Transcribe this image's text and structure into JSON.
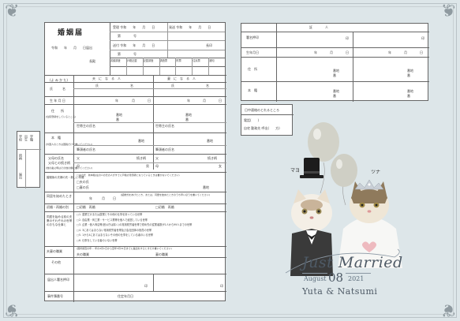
{
  "form": {
    "title": "婚姻届",
    "date_line": "令和　　年　　月　　日届出",
    "addressee": "長殿",
    "receipt": {
      "row1_left": "受理 令和　　年　　月　　日",
      "row1_right": "発送 令和　　年　　月　　日",
      "row2": "第　　　　号",
      "row3": "送付 令和　　年　　月　　日",
      "row3_right": "長印",
      "row4": "第　　　　号",
      "checks": [
        "書類調査",
        "戸籍記載",
        "記載調査",
        "調査票",
        "附票",
        "住民票",
        "通知"
      ]
    },
    "parties": {
      "husband": "夫　に　な　る　人",
      "wife": "妻　に　な　る　人"
    },
    "rows": {
      "furigana": "(よ み か た)",
      "surname_name": [
        "氏",
        "名"
      ],
      "name": "氏　　　名",
      "birth": "生 年 月 日",
      "year": "年",
      "month": "月",
      "day": "日",
      "address": "住　　所",
      "address_sub": "(住民登録をしているところ)",
      "banchi": "番地",
      "ban": "番",
      "go": "号",
      "household_head": "世帯主の氏名",
      "honseki": "本　籍",
      "honseki_sub": "(外国人のときは国籍だけを書いてください)",
      "hittousha": "筆頭者の氏名",
      "parents": "父母の氏名",
      "parents_sub": "父母との続き柄",
      "parents_note": "(他の養父母はその他の欄に書いてください)",
      "father": "父",
      "mother": "母",
      "relation": "続き柄",
      "son": "男",
      "daughter": "女",
      "new_honseki": "婚姻後の夫婦の氏・新しい本籍",
      "new_honseki_note": "□夫の氏　新本籍(左の☑の氏の人がすでに戸籍の筆頭者となっているときは書かないでください)",
      "husband_surname": "□夫の氏",
      "wife_surname": "□妻の氏",
      "cohabit": "同居を始めたとき",
      "cohabit_note": "(結婚式をあげたとき、または、同居を始めたときのうち早いほうを書いてください)",
      "previous": "初婚・再婚の別",
      "first": "□初婚　再婚",
      "death": "(□死別　□離別　年　月　日)",
      "occupation_title": "同居を始める前の夫妻のそれぞれの世帯のおもな仕事と",
      "occupations": [
        "□1. 農業だけまたは農業とその他の仕事を持っている世帯",
        "□2. 自由業・商工業・サービス業等を個人で経営している世帯",
        "□3. 企業・個人商店等(官公庁は除く)の常用勤労者世帯で勤め先の従業者数が1人から99人までの世帯",
        "□4. 3にあてはまらない常用勤労者世帯及び会社団体の役員の世帯",
        "□5. 1から4にあてはまらないその他の仕事をしている者のいる世帯",
        "□6. 仕事をしている者のいない世帯"
      ],
      "occupation_row": "夫妻の職業",
      "census_note": "(国勢調査の年… 年の4月1日から翌年3月31日までに届出をするときだけ書いてください)",
      "husband_job": "夫の職業",
      "wife_job": "妻の職業",
      "other": "その他",
      "signature": "届出人署名押印",
      "seal": "印",
      "contact": "事件簿番号",
      "daytime": "住定年月日",
      "phone_label": "日中連絡のとれるところ",
      "phone_home": "電話(　　)",
      "phone_type": "自宅 勤務先 呼出(　　方)",
      "side_labels": [
        "学校",
        "出生",
        "学籍"
      ],
      "side_labels2": [
        "続柄",
        "届出"
      ]
    },
    "witness": {
      "header": "証　　　　人",
      "signature": "署名押印",
      "seal": "印",
      "birth": "生年月日",
      "address": "住　所",
      "honseki": "本　籍",
      "year": "年",
      "month": "月",
      "day": "日",
      "banchi": "番地",
      "ban": "番"
    }
  },
  "decoration": {
    "title": "Just Married",
    "month": "August",
    "day": "08",
    "year": "2021",
    "names": "Yuta & Natsumi",
    "husband_tag": "マヨ",
    "wife_tag": "ツナ"
  },
  "colors": {
    "background": "#dde6e9",
    "balloon": "#d2d2c8",
    "accent": "#5a6b7a",
    "title_text": "#4e5a66"
  }
}
